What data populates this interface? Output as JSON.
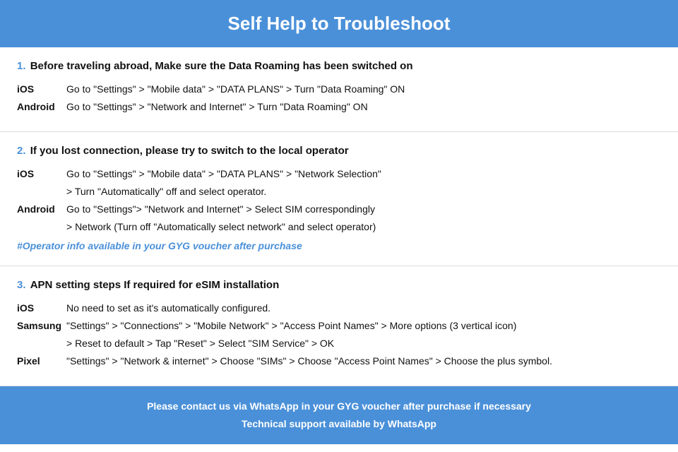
{
  "header": {
    "title": "Self Help to Troubleshoot"
  },
  "sections": [
    {
      "number": "1.",
      "title": "Before traveling abroad, Make sure the Data Roaming has been switched on",
      "instructions": [
        {
          "platform": "iOS",
          "text": "Go to \"Settings\" > \"Mobile data\" > \"DATA PLANS\" > Turn \"Data Roaming\" ON",
          "continuation": null
        },
        {
          "platform": "Android",
          "text": "Go to \"Settings\" > \"Network and Internet\" > Turn \"Data Roaming\" ON",
          "continuation": null
        }
      ],
      "note": null
    },
    {
      "number": "2.",
      "title": "If you lost connection, please try to switch to the local operator",
      "instructions": [
        {
          "platform": "iOS",
          "text": "Go to \"Settings\" > \"Mobile data\" > \"DATA PLANS\" > \"Network Selection\"",
          "continuation": "> Turn \"Automatically\" off and select operator."
        },
        {
          "platform": "Android",
          "text": "Go to \"Settings\">  \"Network and Internet\" > Select SIM correspondingly",
          "continuation": "> Network (Turn off \"Automatically select network\" and select operator)"
        }
      ],
      "note": "#Operator info available in your GYG voucher after purchase"
    },
    {
      "number": "3.",
      "title": "APN setting steps If required for eSIM installation",
      "instructions": [
        {
          "platform": "iOS",
          "text": "No need to set as it's automatically configured.",
          "continuation": null
        },
        {
          "platform": "Samsung",
          "text": "\"Settings\" > \"Connections\" > \"Mobile Network\" > \"Access Point Names\" > More options (3 vertical icon)",
          "continuation": "> Reset to default > Tap \"Reset\" > Select \"SIM Service\" > OK"
        },
        {
          "platform": "Pixel",
          "text": "\"Settings\" > \"Network & internet\" > Choose \"SIMs\" > Choose \"Access Point Names\" > Choose the plus symbol.",
          "continuation": null
        }
      ],
      "note": null
    }
  ],
  "footer": {
    "line1": "Please contact us via WhatsApp  in your GYG voucher after purchase if necessary",
    "line2": "Technical support available by WhatsApp"
  }
}
